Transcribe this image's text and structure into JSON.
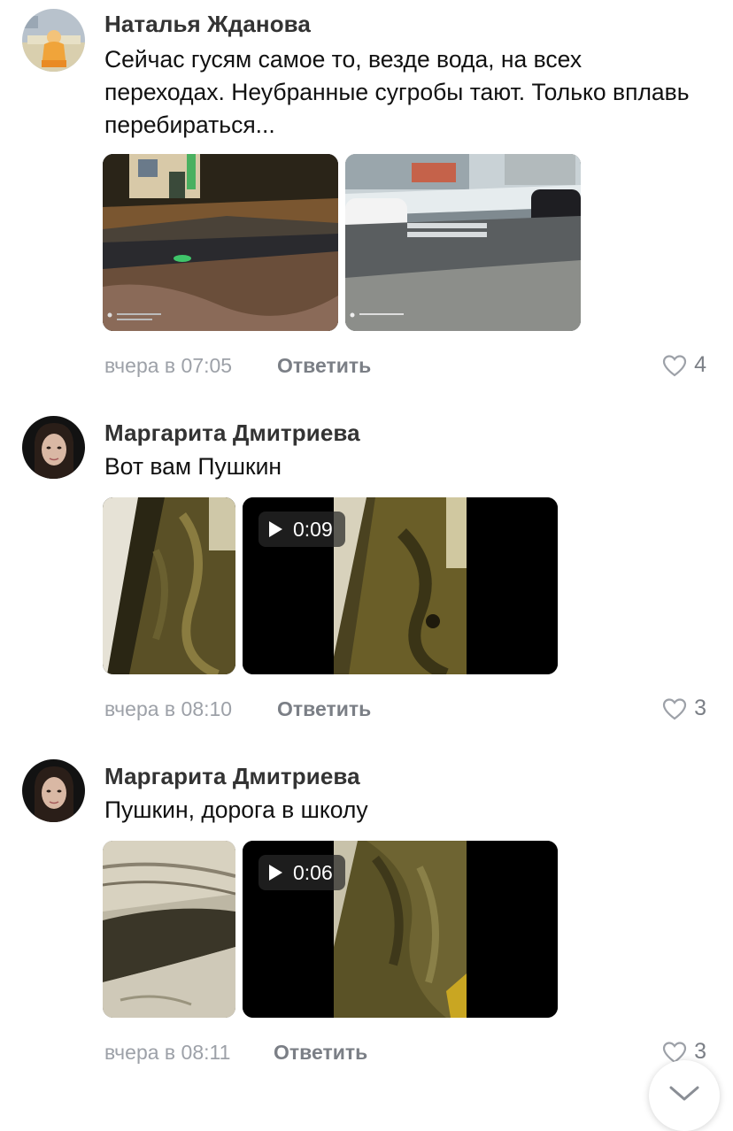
{
  "comments": [
    {
      "author": "Наталья Жданова",
      "text": "Сейчас гусям самое то, везде вода, на всех переходах. Неубранные сугробы тают. Только вплавь перебираться...",
      "time": "вчера в 07:05",
      "reply_label": "Ответить",
      "likes": "4",
      "media": [
        {
          "type": "photo",
          "icon": "photo-night-crosswalk",
          "watermark_date": "07.02.2022 14:37"
        },
        {
          "type": "photo",
          "icon": "photo-street-car",
          "watermark_date": "07.02.2022 17:01"
        }
      ]
    },
    {
      "author": "Маргарита Дмитриева",
      "text": "Вот вам Пушкин",
      "time": "вчера в 08:10",
      "reply_label": "Ответить",
      "likes": "3",
      "media": [
        {
          "type": "photo",
          "icon": "photo-icy-road"
        },
        {
          "type": "video",
          "duration": "0:09",
          "icon": "video-thumbnail"
        }
      ]
    },
    {
      "author": "Маргарита Дмитриева",
      "text": "Пушкин, дорога в школу",
      "time": "вчера в 08:11",
      "reply_label": "Ответить",
      "likes": "3",
      "media": [
        {
          "type": "photo",
          "icon": "photo-snowy-puddle"
        },
        {
          "type": "video",
          "duration": "0:06",
          "icon": "video-thumbnail"
        }
      ]
    }
  ],
  "colors": {
    "meta": "#9da1a8",
    "reply": "#7b7f86",
    "author": "#333333",
    "video_bg": "#000000"
  }
}
